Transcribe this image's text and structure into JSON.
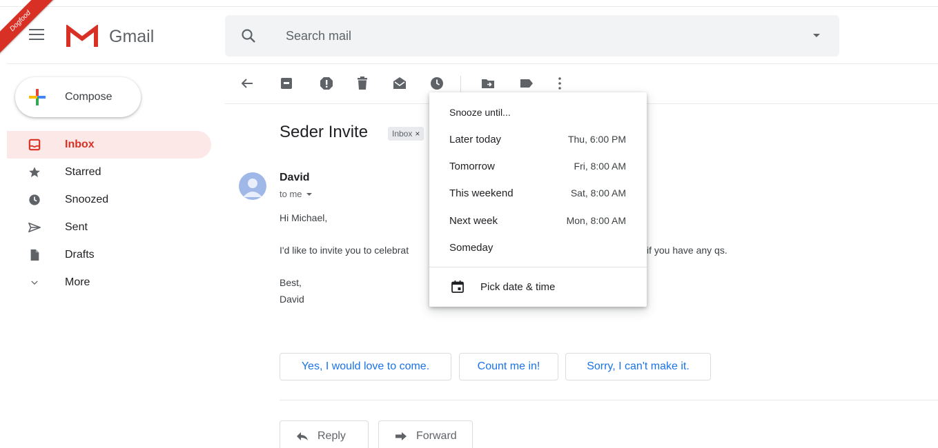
{
  "app": {
    "ribbon": "Dogfood",
    "name": "Gmail"
  },
  "search": {
    "placeholder": "Search mail"
  },
  "compose": {
    "label": "Compose"
  },
  "sidebar": {
    "items": [
      {
        "label": "Inbox",
        "icon": "inbox-icon",
        "active": true
      },
      {
        "label": "Starred",
        "icon": "star-icon"
      },
      {
        "label": "Snoozed",
        "icon": "clock-icon"
      },
      {
        "label": "Sent",
        "icon": "send-icon"
      },
      {
        "label": "Drafts",
        "icon": "draft-icon"
      },
      {
        "label": "More",
        "icon": "chevron-down-icon"
      }
    ]
  },
  "toolbar": {
    "icons": [
      "back-arrow-icon",
      "archive-icon",
      "report-spam-icon",
      "delete-icon",
      "mark-unread-icon",
      "snooze-icon",
      "move-to-icon",
      "label-icon",
      "more-vert-icon"
    ]
  },
  "email": {
    "subject": "Seder Invite",
    "label": "Inbox",
    "label_remove": "×",
    "sender": "David",
    "recipient": "to me",
    "greeting": "Hi Michael,",
    "body_left": "I'd like to invite you to celebrat",
    "body_right": "if you have any qs.",
    "signoff": "Best,",
    "signature": "David"
  },
  "smart_replies": [
    "Yes, I would love to come.",
    "Count me in!",
    "Sorry, I can't make it."
  ],
  "actions": {
    "reply": "Reply",
    "forward": "Forward"
  },
  "snooze_menu": {
    "title": "Snooze until...",
    "options": [
      {
        "label": "Later today",
        "time": "Thu, 6:00 PM"
      },
      {
        "label": "Tomorrow",
        "time": "Fri, 8:00 AM"
      },
      {
        "label": "This weekend",
        "time": "Sat, 8:00 AM"
      },
      {
        "label": "Next week",
        "time": "Mon, 8:00 AM"
      },
      {
        "label": "Someday",
        "time": ""
      }
    ],
    "pick_label": "Pick date & time"
  },
  "colors": {
    "accent_red": "#d93025",
    "link_blue": "#1a73e8",
    "active_bg": "#fce8e6"
  }
}
